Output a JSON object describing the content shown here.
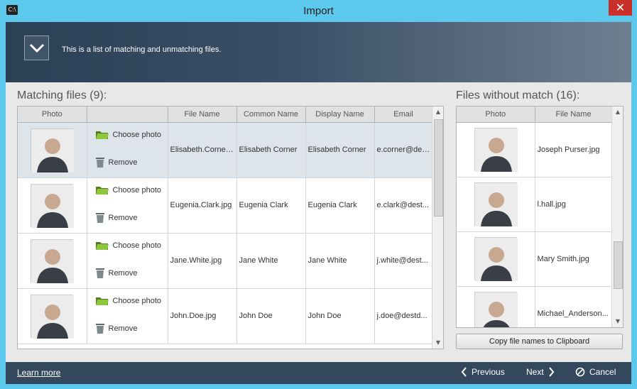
{
  "window": {
    "title": "Import",
    "app_icon_label": "C:\\"
  },
  "banner": {
    "text": "This is a list of matching and unmatching files."
  },
  "matching": {
    "title": "Matching files (9):",
    "columns": [
      "Photo",
      "",
      "File Name",
      "Common Name",
      "Display Name",
      "Email"
    ],
    "choose_label": "Choose photo",
    "remove_label": "Remove",
    "rows": [
      {
        "file": "Elisabeth.Corner...",
        "common": "Elisabeth Corner",
        "display": "Elisabeth Corner",
        "email": "e.corner@dest...",
        "selected": true
      },
      {
        "file": "Eugenia.Clark.jpg",
        "common": "Eugenia Clark",
        "display": "Eugenia Clark",
        "email": "e.clark@dest...",
        "selected": false
      },
      {
        "file": "Jane.White.jpg",
        "common": "Jane White",
        "display": "Jane White",
        "email": "j.white@dest...",
        "selected": false
      },
      {
        "file": "John.Doe.jpg",
        "common": "John Doe",
        "display": "John Doe",
        "email": "j.doe@destd...",
        "selected": false
      }
    ]
  },
  "unmatched": {
    "title": "Files without match (16):",
    "columns": [
      "Photo",
      "File Name"
    ],
    "rows": [
      {
        "file": "Joseph Purser.jpg"
      },
      {
        "file": "l.hall.jpg"
      },
      {
        "file": "Mary Smith.jpg"
      },
      {
        "file": "Michael_Anderson..."
      }
    ],
    "copy_button": "Copy file names to Clipboard"
  },
  "footer": {
    "learn_more": "Learn more",
    "previous": "Previous",
    "next": "Next",
    "cancel": "Cancel"
  },
  "colors": {
    "accent": "#5bc8ec",
    "footer": "#34485d",
    "folder": "#8dc63f"
  },
  "icons": [
    "chevron-down-icon",
    "folder-icon",
    "trash-icon",
    "chevron-left-icon",
    "chevron-right-icon",
    "cancel-icon",
    "close-icon"
  ]
}
